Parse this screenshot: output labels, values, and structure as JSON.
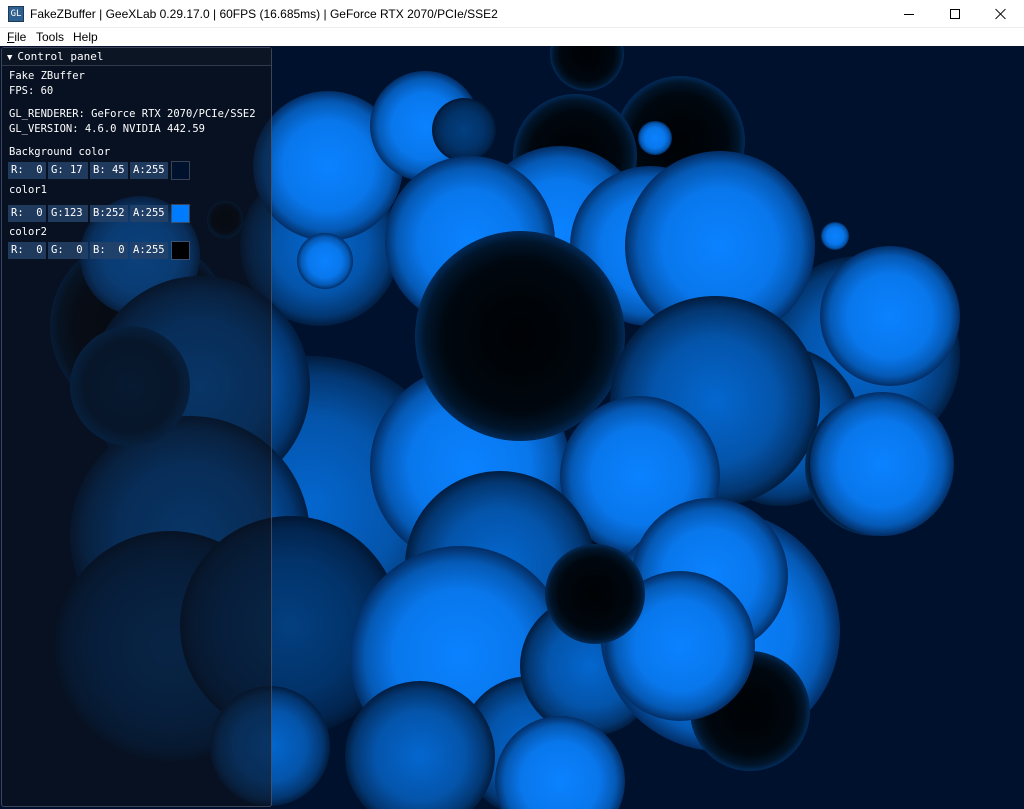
{
  "window": {
    "app_icon_label": "GL",
    "title": "FakeZBuffer | GeeXLab 0.29.17.0 | 60FPS (16.685ms) | GeForce RTX 2070/PCIe/SSE2"
  },
  "menu": {
    "file_mnemonic": "F",
    "file_rest": "ile",
    "tools": "Tools",
    "help": "Help"
  },
  "colors": {
    "background": "#00112d",
    "color1": "#007bfc",
    "color2": "#000000"
  },
  "panel": {
    "header": "Control panel",
    "caret": "▼",
    "demo_name": "Fake ZBuffer",
    "fps": "FPS: 60",
    "gl_renderer": "GL_RENDERER: GeForce RTX 2070/PCIe/SSE2",
    "gl_version": "GL_VERSION: 4.6.0 NVIDIA 442.59",
    "background_color": {
      "label": "Background color",
      "r": "R:  0",
      "g": "G: 17",
      "b": "B: 45",
      "a": "A:255"
    },
    "color1": {
      "label": "color1",
      "r": "R:  0",
      "g": "G:123",
      "b": "B:252",
      "a": "A:255"
    },
    "color2": {
      "label": "color2",
      "r": "R:  0",
      "g": "G:  0",
      "b": "B:  0",
      "a": "A:255"
    }
  }
}
